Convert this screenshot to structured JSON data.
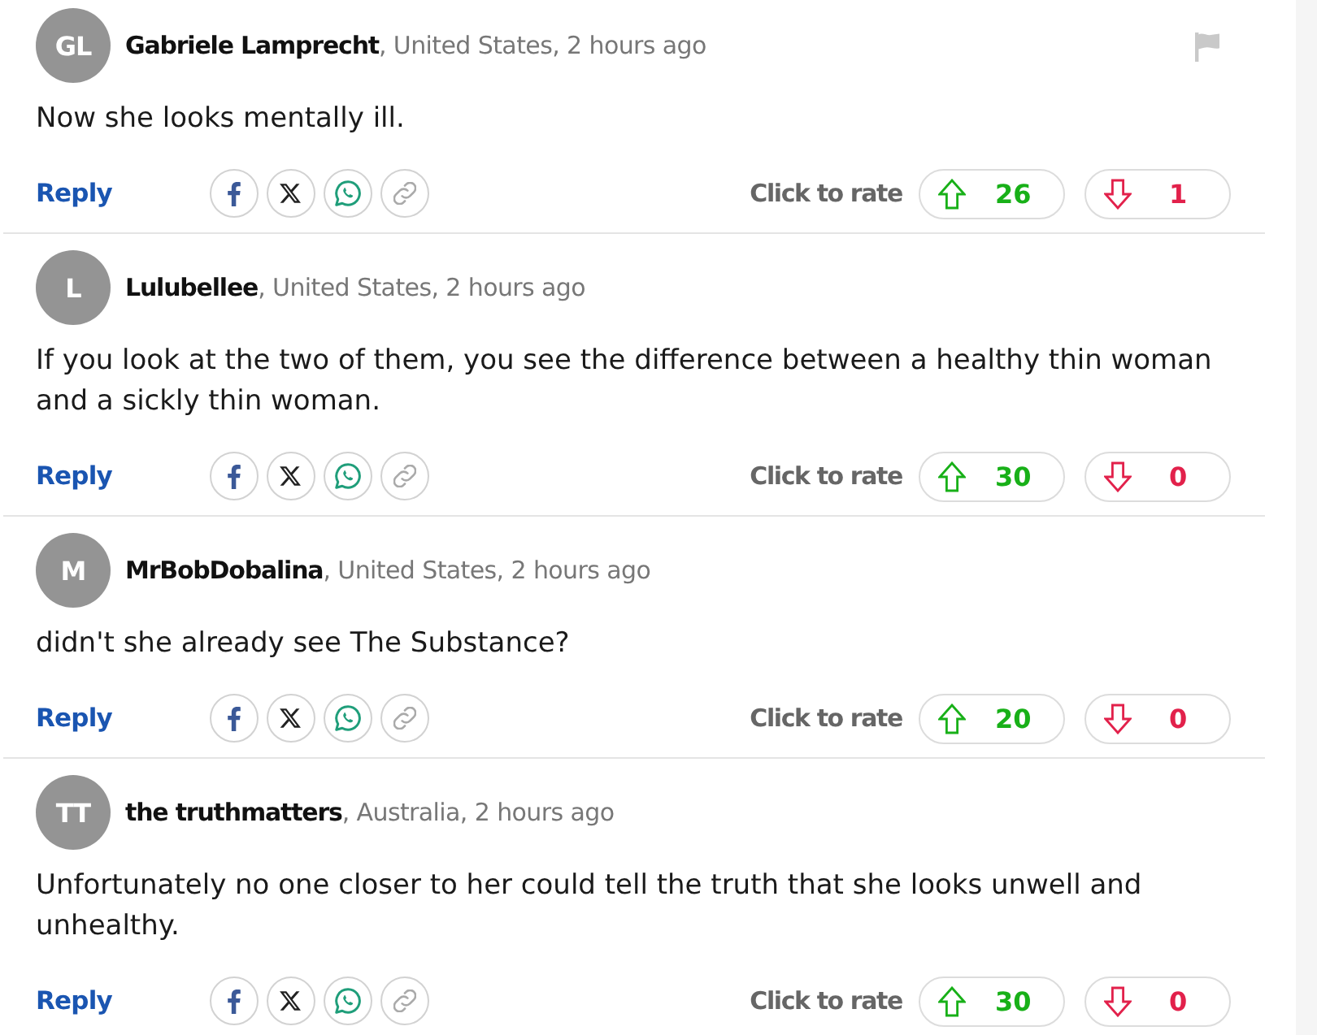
{
  "comments": [
    {
      "avatar_initials": "GL",
      "byline": "**Gabriele Lamprecht**, United States, 2 hours ago",
      "show_flag": true,
      "text": "Now she looks mentally ill.",
      "reply": "Reply",
      "rate_label": "Click to rate",
      "upvotes": "26",
      "downvotes": "1"
    },
    {
      "avatar_initials": "L",
      "byline": "**Lulubellee**, United States, 2 hours ago",
      "show_flag": false,
      "text": "If you look at the two of them, you see the difference between a healthy thin woman and a sickly thin woman.",
      "reply": "Reply",
      "rate_label": "Click to rate",
      "upvotes": "30",
      "downvotes": "0"
    },
    {
      "avatar_initials": "M",
      "byline": "**MrBobDobalina**, United States, 2 hours ago",
      "show_flag": false,
      "text": "didn't she already see The Substance?",
      "reply": "Reply",
      "rate_label": "Click to rate",
      "upvotes": "20",
      "downvotes": "0"
    },
    {
      "avatar_initials": "TT",
      "byline": "**the truthmatters**, Australia, 2 hours ago",
      "show_flag": false,
      "text": "Unfortunately no one closer to her could tell the truth that she looks unwell and unhealthy.",
      "reply": "Reply",
      "rate_label": "Click to rate",
      "upvotes": "30",
      "downvotes": "0"
    }
  ]
}
